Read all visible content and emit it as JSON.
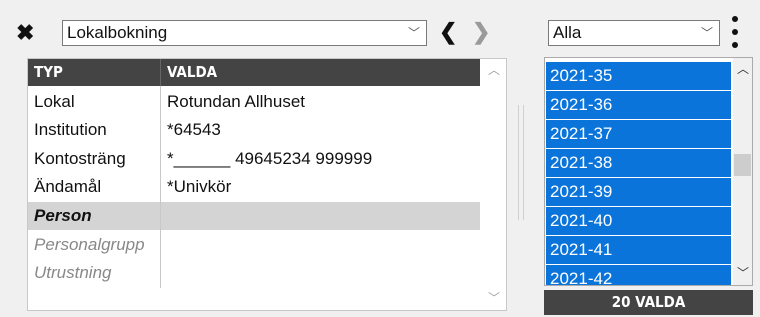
{
  "toolbar": {
    "close_glyph": "✖",
    "view_select": "Lokalbokning",
    "prev_glyph": "❮",
    "next_glyph": "❯",
    "dropdown_glyph": "﹀"
  },
  "table": {
    "headers": [
      "TYP",
      "VALDA"
    ],
    "rows": [
      {
        "type": "Lokal",
        "value": "Rotundan Allhuset"
      },
      {
        "type": "Institution",
        "value": "*64543"
      },
      {
        "type": "Kontosträng",
        "value": "*______ 49645234 999999"
      },
      {
        "type": "Ändamål",
        "value": "*Univkör"
      },
      {
        "type": "Person",
        "value": ""
      },
      {
        "type": "Personalgrupp",
        "value": ""
      },
      {
        "type": "Utrustning",
        "value": ""
      }
    ],
    "scroll_up_glyph": "︿",
    "scroll_down_glyph": "﹀"
  },
  "right": {
    "filter_select": "Alla",
    "weeks": [
      "2021-35",
      "2021-36",
      "2021-37",
      "2021-38",
      "2021-39",
      "2021-40",
      "2021-41",
      "2021-42"
    ],
    "selected_count_label": "20 VALDA",
    "scroll_up_glyph": "︿",
    "scroll_down_glyph": "﹀"
  },
  "colors": {
    "header_bg": "#444444",
    "selection_blue": "#0a74da",
    "selected_row_bg": "#d4d4d4"
  }
}
